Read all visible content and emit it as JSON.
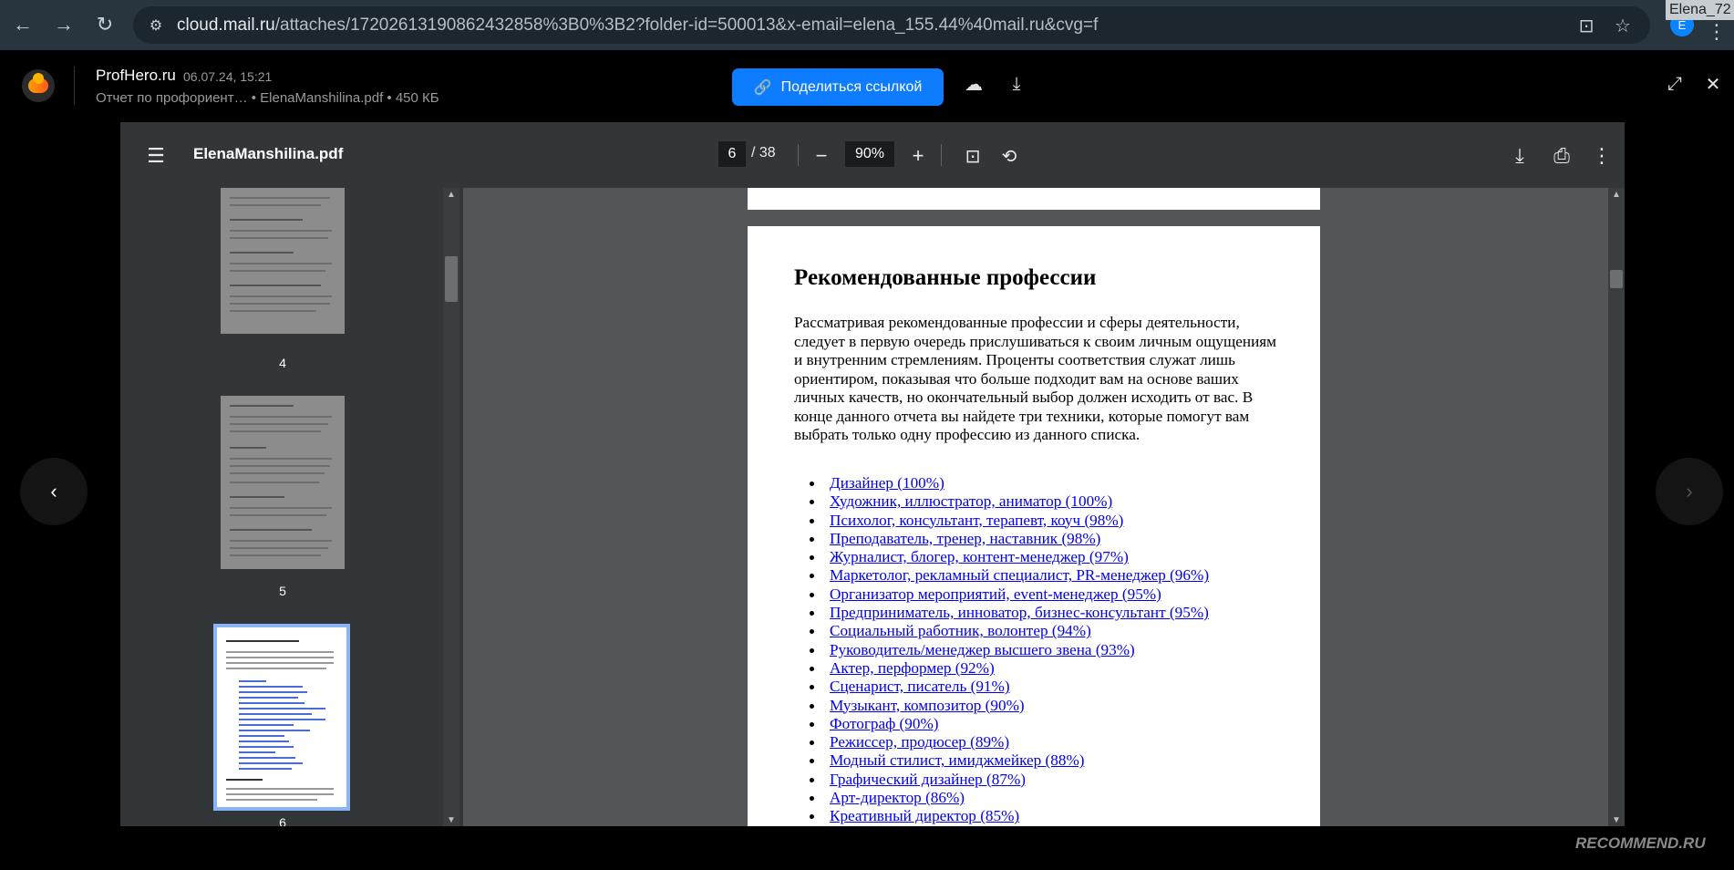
{
  "browser": {
    "url_host": "cloud.mail.ru",
    "url_rest": "/attaches/17202613190862432858%3B0%3B2?folder-id=500013&x-email=elena_155.44%40mail.ru&cvg=f",
    "profile_name": "Elena_72",
    "avatar_letter": "E"
  },
  "header": {
    "sender": "ProfHero.ru",
    "date": "06.07.24, 15:21",
    "file_info": "Отчет по профориент…  • ElenaManshilina.pdf • 450 КБ",
    "share_label": "Поделиться ссылкой"
  },
  "pdf": {
    "filename": "ElenaManshilina.pdf",
    "current_page": "6",
    "total_pages": "/ 38",
    "zoom": "90%"
  },
  "thumbnails": [
    {
      "number": "4"
    },
    {
      "number": "5"
    },
    {
      "number": "6",
      "selected": true
    }
  ],
  "page_content": {
    "heading": "Рекомендованные профессии",
    "intro": "Рассматривая рекомендованные профессии и сферы деятельности, следует в первую очередь прислушиваться к своим личным ощущениям и внутренним стремлениям. Проценты соответствия служат лишь ориентиром, показывая что больше подходит вам на основе ваших личных качеств, но окончательный выбор должен исходить от вас. В конце данного отчета вы найдете три техники, которые помогут вам выбрать только одну профессию из данного списка.",
    "professions": [
      "Дизайнер (100%)",
      "Художник, иллюстратор, аниматор (100%)",
      "Психолог, консультант, терапевт, коуч (98%)",
      "Преподаватель, тренер, наставник (98%)",
      "Журналист, блогер, контент-менеджер (97%)",
      "Маркетолог, рекламный специалист, PR-менеджер (96%)",
      "Организатор мероприятий, event-менеджер (95%)",
      "Предприниматель, инноватор, бизнес-консультант (95%)",
      "Социальный работник, волонтер (94%)",
      "Руководитель/менеджер высшего звена (93%)",
      "Актер, перформер (92%)",
      "Сценарист, писатель (91%)",
      "Музыкант, композитор (90%)",
      "Фотограф (90%)",
      "Режиссер, продюсер (89%)",
      "Модный стилист, имиджмейкер (88%)",
      "Графический дизайнер (87%)",
      "Арт-директор (86%)",
      "Креативный директор (85%)"
    ]
  },
  "watermark": "RECOMMEND.RU",
  "colors": {
    "accent": "#0d7cff",
    "toolbar": "#323639",
    "viewer_bg": "#525659",
    "link": "#0000ee"
  }
}
